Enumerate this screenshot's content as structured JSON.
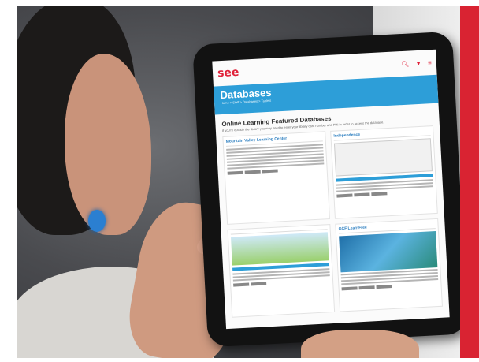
{
  "screen": {
    "logo_text": "see",
    "logo_sub": "",
    "title": "Databases",
    "breadcrumb": "Home > Staff > Databases > Tablets",
    "featured_heading": "Online Learning Featured Databases",
    "featured_intro": "If you're outside the library you may need to enter your library card number and PIN in order to access the database.",
    "cards": [
      {
        "title": "Mountain Valley Learning Center"
      },
      {
        "title": "Independence"
      },
      {
        "title": ""
      },
      {
        "title": "GCF LearnFree"
      }
    ]
  },
  "icons": [
    "search-icon",
    "location-pin-icon",
    "menu-icon"
  ],
  "colors": {
    "accent": "#e0223a",
    "banner": "#2d9ed8",
    "edge": "#d92332"
  }
}
